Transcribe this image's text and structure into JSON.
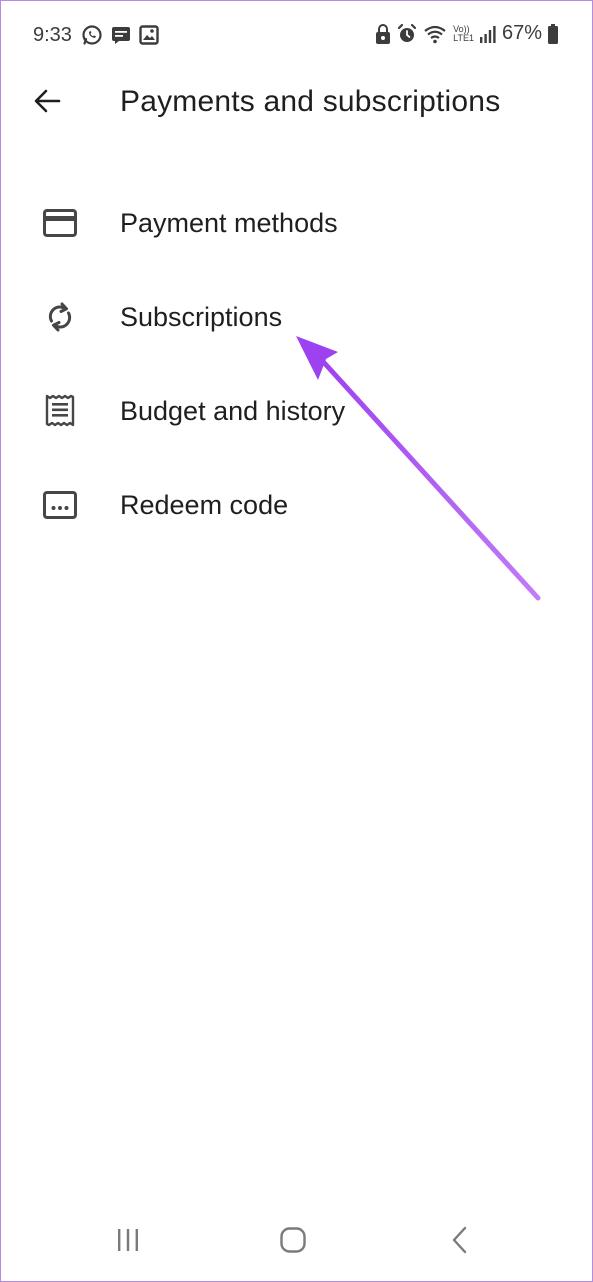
{
  "status_bar": {
    "time": "9:33",
    "battery_percent": "67%",
    "left_icons": [
      "whatsapp-icon",
      "message-icon",
      "gallery-icon"
    ],
    "right_icons": [
      "lock-icon",
      "alarm-icon",
      "wifi-icon",
      "volte-icon",
      "signal-icon",
      "battery-icon"
    ],
    "network_label_top": "Vo))",
    "network_label_bottom": "LTE1"
  },
  "header": {
    "title": "Payments and subscriptions",
    "back_icon": "arrow-back-icon"
  },
  "menu": {
    "items": [
      {
        "label": "Payment methods",
        "icon": "credit-card-icon"
      },
      {
        "label": "Subscriptions",
        "icon": "sync-icon"
      },
      {
        "label": "Budget and history",
        "icon": "receipt-icon"
      },
      {
        "label": "Redeem code",
        "icon": "redeem-code-icon"
      }
    ]
  },
  "annotation": {
    "color": "#a64df0",
    "target": "Subscriptions"
  },
  "nav_bar": {
    "icons": [
      "recent-apps-icon",
      "home-icon",
      "back-icon"
    ]
  },
  "colors": {
    "text_primary": "#1f1f1f",
    "icon": "#444746",
    "frame_border": "#b68ce0"
  }
}
